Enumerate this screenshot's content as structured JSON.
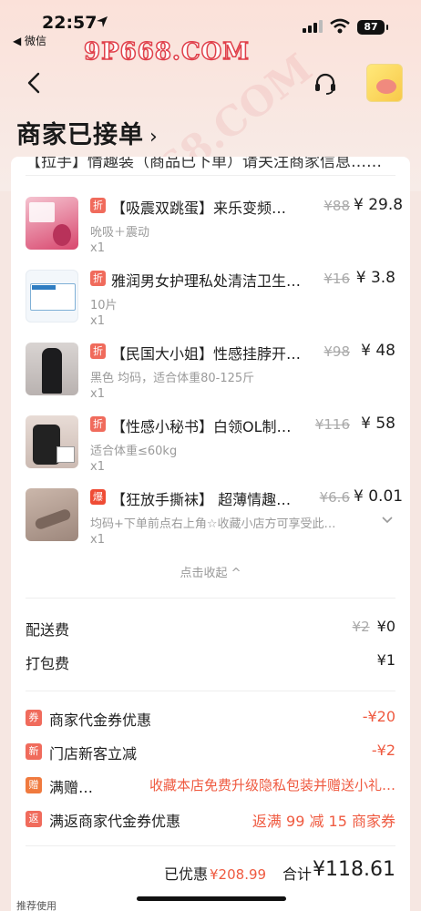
{
  "status_bar": {
    "time": "22:57",
    "back_app": "◀ 微信",
    "battery": "87"
  },
  "watermark": {
    "text": "9P668.COM",
    "diagonal": "9P668.COM"
  },
  "header": {
    "order_status": "商家已接单",
    "chevron": "›"
  },
  "cut_text": "【拉手】情趣装（商品已下单）请关注商家信息……",
  "items": [
    {
      "tag": "折",
      "name": "【吸震双跳蛋】来乐变频…",
      "orig_price": "¥88",
      "price": "¥ 29.8",
      "spec": "吮吸＋震动",
      "qty": "x1"
    },
    {
      "tag": "折",
      "name": "雅润男女护理私处清洁卫生…",
      "orig_price": "¥16",
      "price": "¥ 3.8",
      "spec": "10片",
      "qty": "x1"
    },
    {
      "tag": "折",
      "name": "【民国大小姐】性感挂脖开…",
      "orig_price": "¥98",
      "price": "¥ 48",
      "spec": "黑色 均码，适合体重80-125斤",
      "qty": "x1"
    },
    {
      "tag": "折",
      "name": "【性感小秘书】白领OL制…",
      "orig_price": "¥116",
      "price": "¥ 58",
      "spec": "适合体重≤60kg",
      "qty": "x1"
    },
    {
      "tag": "爆",
      "name": "【狂放手撕袜】 超薄情趣…",
      "orig_price": "¥6.6",
      "price": "¥ 0.01",
      "spec": "均码+下单前点右上角☆收藏小店方可享受此…",
      "qty": "x1"
    }
  ],
  "collapse_label": "点击收起 ^",
  "fees": {
    "delivery_label": "配送费",
    "delivery_orig": "¥2",
    "delivery_value": "¥0",
    "packing_label": "打包费",
    "packing_value": "¥1"
  },
  "discounts": [
    {
      "icon": "券",
      "label": "商家代金券优惠",
      "value": "-¥20"
    },
    {
      "icon": "新",
      "label": "门店新客立减",
      "value": "-¥2"
    },
    {
      "icon": "赠",
      "label": "满赠…",
      "value": "收藏本店免费升级隐私包装并赠送小礼…"
    },
    {
      "icon": "返",
      "label": "满返商家代金券优惠",
      "value": "返满 99 减 15 商家券"
    }
  ],
  "total": {
    "saved_label": "已优惠",
    "saved_value": "¥208.99",
    "sum_label": "合计",
    "sum_value": "¥118.61"
  },
  "bottom_hint": "推荐使用",
  "colors": {
    "accent": "#ef5a40",
    "tag": "#f06b5c",
    "background": "#f6e7e2"
  }
}
